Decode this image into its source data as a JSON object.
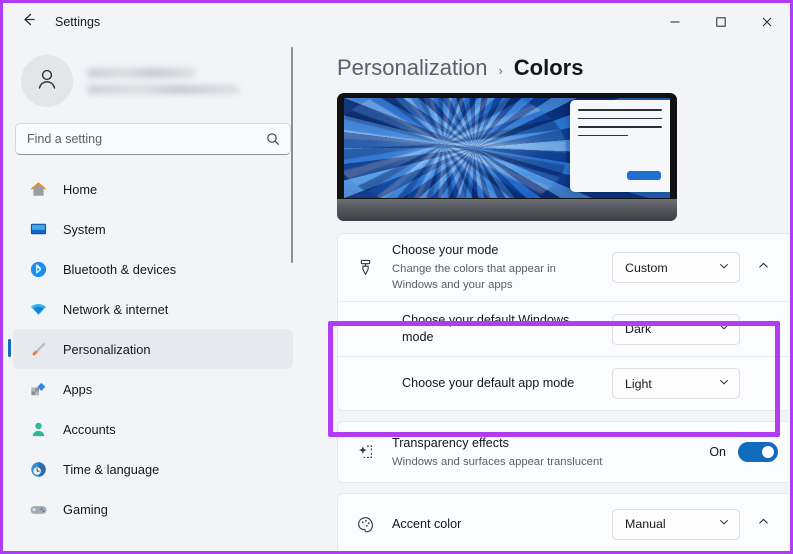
{
  "window": {
    "app_title": "Settings",
    "back_icon": "back-arrow-icon",
    "minimize_label": "—",
    "maximize_label": "□",
    "close_label": "✕"
  },
  "sidebar": {
    "account": {
      "name_redacted": "",
      "email_redacted": "",
      "avatar_icon": "person-icon"
    },
    "search": {
      "placeholder": "Find a setting",
      "value": "",
      "icon": "search-icon"
    },
    "items": [
      {
        "label": "Home",
        "icon": "home-icon",
        "selected": false
      },
      {
        "label": "System",
        "icon": "system-icon",
        "selected": false
      },
      {
        "label": "Bluetooth & devices",
        "icon": "bluetooth-icon",
        "selected": false
      },
      {
        "label": "Network & internet",
        "icon": "wifi-icon",
        "selected": false
      },
      {
        "label": "Personalization",
        "icon": "paintbrush-icon",
        "selected": true
      },
      {
        "label": "Apps",
        "icon": "apps-icon",
        "selected": false
      },
      {
        "label": "Accounts",
        "icon": "accounts-icon",
        "selected": false
      },
      {
        "label": "Time & language",
        "icon": "clock-icon",
        "selected": false
      },
      {
        "label": "Gaming",
        "icon": "gamepad-icon",
        "selected": false
      }
    ]
  },
  "breadcrumb": {
    "parent": "Personalization",
    "separator": "›",
    "current": "Colors"
  },
  "preview": {
    "alt": "laptop-colors-preview"
  },
  "settings": {
    "mode_card": {
      "icon": "paintbrush-outline-icon",
      "title": "Choose your mode",
      "subtitle": "Change the colors that appear in Windows and your apps",
      "dropdown_value": "Custom",
      "expander_icon": "chevron-up-icon",
      "sub_rows": [
        {
          "title": "Choose your default Windows mode",
          "dropdown_value": "Dark"
        },
        {
          "title": "Choose your default app mode",
          "dropdown_value": "Light"
        }
      ]
    },
    "transparency": {
      "icon": "sparkle-dashed-icon",
      "title": "Transparency effects",
      "subtitle": "Windows and surfaces appear translucent",
      "toggle_label": "On",
      "toggle_on": true
    },
    "accent": {
      "icon": "palette-icon",
      "title": "Accent color",
      "dropdown_value": "Manual",
      "expander_icon": "chevron-up-icon"
    }
  },
  "colors": {
    "annotation_purple": "#b13cf7",
    "accent_blue": "#0f6cbd",
    "page_background": "#f2f4f8",
    "card_background": "#fbfcfe"
  }
}
